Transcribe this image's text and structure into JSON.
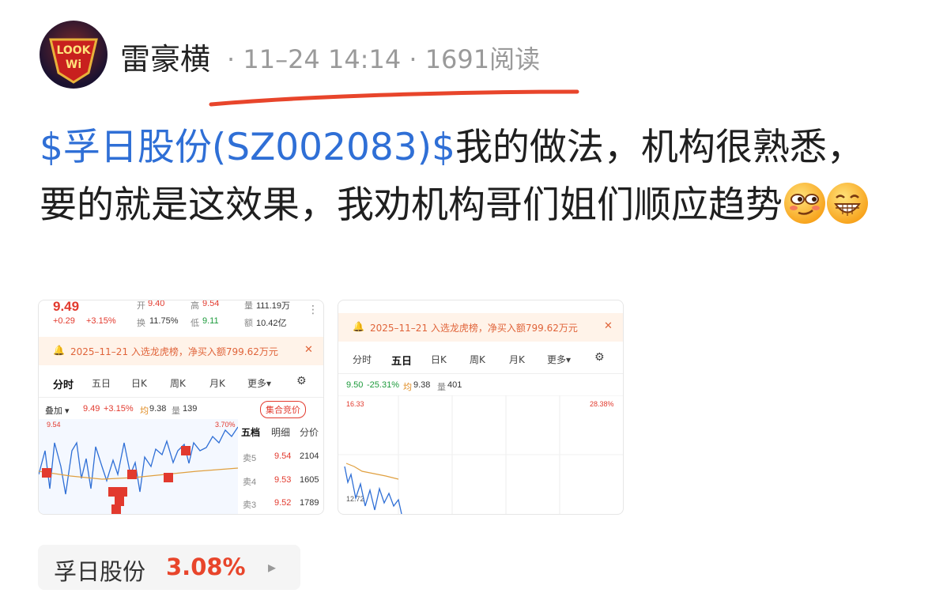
{
  "post": {
    "author": "雷豪横",
    "separator": "·",
    "time": "11–24 14:14",
    "reads": "1691阅读",
    "avatar_text": "LOOK Wi",
    "stock_tag": "$孚日股份(SZ002083)$",
    "body": "我的做法，机构很熟悉，要的就是这效果，我劝机构哥们姐们顺应趋势",
    "emojis": [
      "smirk-face-icon",
      "grinning-face-icon"
    ],
    "accent_link_color": "#2f6fd6",
    "underline_color": "#e8452b"
  },
  "image1": {
    "price": "9.49",
    "change": "+0.29",
    "change_pct": "+3.15%",
    "sheng_label": "开",
    "sheng_val": "9.40",
    "gao_label": "高",
    "gao_val": "9.54",
    "liang_label": "量",
    "liang_val": "111.19万",
    "huan_label": "换",
    "huan_val": "11.75%",
    "di_label": "低",
    "di_val": "9.11",
    "e_label": "额",
    "e_val": "10.42亿",
    "notice": "2025–11–21 入选龙虎榜，净买入额799.62万元",
    "tabs": [
      "分时",
      "五日",
      "日K",
      "周K",
      "月K",
      "更多▾"
    ],
    "stat_row": {
      "mode": "叠加 ▾",
      "price": "9.49",
      "pct": "+3.15%",
      "avg_label": "均",
      "avg": "9.38",
      "vol_label": "量",
      "vol": "139"
    },
    "auction_button": "集合竞价",
    "y_top": "9.54",
    "pct_top": "3.70%",
    "buy_marks": [
      "买",
      "买",
      "买",
      "买",
      "买",
      "买",
      "买",
      "买"
    ],
    "order_tabs": [
      "五档",
      "明细",
      "分价"
    ],
    "asks": [
      {
        "label": "卖5",
        "price": "9.54",
        "vol": "2104"
      },
      {
        "label": "卖4",
        "price": "9.53",
        "vol": "1605"
      },
      {
        "label": "卖3",
        "price": "9.52",
        "vol": "1789"
      }
    ]
  },
  "image2": {
    "notice": "2025–11–21 入选龙虎榜，净买入额799.62万元",
    "tabs": [
      "分时",
      "五日",
      "日K",
      "周K",
      "月K",
      "更多▾"
    ],
    "stat_row": {
      "price": "9.50",
      "pct": "-25.31%",
      "avg_label": "均",
      "avg": "9.38",
      "vol_label": "量",
      "vol": "401"
    },
    "y_top": "16.33",
    "pct_top": "28.38%",
    "y_mid": "12.72"
  },
  "chip": {
    "name": "孚日股份",
    "pct": "3.08%",
    "arrow": "▸"
  }
}
